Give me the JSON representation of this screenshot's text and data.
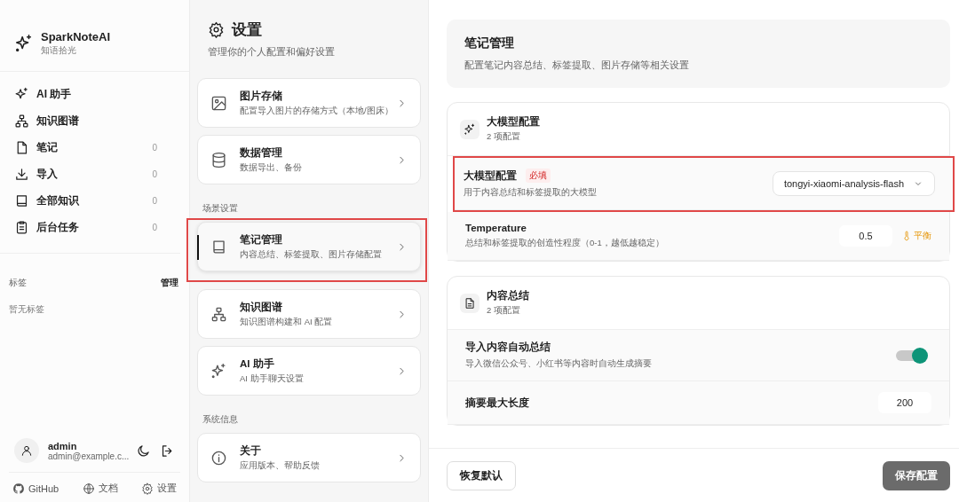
{
  "sidebar": {
    "brand": {
      "name": "SparkNoteAI",
      "tagline": "知语拾光"
    },
    "nav": [
      {
        "label": "AI 助手"
      },
      {
        "label": "知识图谱"
      },
      {
        "label": "笔记",
        "count": "0"
      },
      {
        "label": "导入",
        "count": "0"
      },
      {
        "label": "全部知识",
        "count": "0"
      },
      {
        "label": "后台任务",
        "count": "0"
      }
    ],
    "tags": {
      "title": "标签",
      "action": "管理",
      "empty": "暂无标签"
    },
    "user": {
      "name": "admin",
      "email": "admin@example.c..."
    },
    "links": [
      {
        "label": "GitHub"
      },
      {
        "label": "文档"
      },
      {
        "label": "设置"
      }
    ]
  },
  "settings_nav": {
    "title": "设置",
    "subtitle": "管理你的个人配置和偏好设置",
    "groups": [
      {
        "items": [
          {
            "title": "图片存储",
            "desc": "配置导入图片的存储方式（本地/图床）",
            "selected": false,
            "highlighted": false
          },
          {
            "title": "数据管理",
            "desc": "数据导出、备份",
            "selected": false,
            "highlighted": false
          }
        ]
      },
      {
        "label": "场景设置",
        "items": [
          {
            "title": "笔记管理",
            "desc": "内容总结、标签提取、图片存储配置",
            "selected": true,
            "highlighted": true
          },
          {
            "title": "知识图谱",
            "desc": "知识图谱构建和 AI 配置",
            "selected": false,
            "highlighted": false
          },
          {
            "title": "AI 助手",
            "desc": "AI 助手聊天设置",
            "selected": false,
            "highlighted": false
          }
        ]
      },
      {
        "label": "系统信息",
        "items": [
          {
            "title": "关于",
            "desc": "应用版本、帮助反馈",
            "selected": false,
            "highlighted": false
          }
        ]
      }
    ]
  },
  "content": {
    "title": "笔记管理",
    "subtitle": "配置笔记内容总结、标签提取、图片存储等相关设置",
    "sections": [
      {
        "title": "大模型配置",
        "count": "2 项配置",
        "rows": [
          {
            "kind": "select",
            "label": "大模型配置",
            "badge": "必填",
            "desc": "用于内容总结和标签提取的大模型",
            "value": "tongyi-xiaomi-analysis-flash",
            "highlighted": true
          },
          {
            "kind": "number",
            "label": "Temperature",
            "desc": "总结和标签提取的创造性程度（0-1，越低越稳定）",
            "value": "0.5",
            "hint": "平衡",
            "highlighted": false
          }
        ]
      },
      {
        "title": "内容总结",
        "count": "2 项配置",
        "rows": [
          {
            "kind": "toggle",
            "label": "导入内容自动总结",
            "desc": "导入微信公众号、小红书等内容时自动生成摘要",
            "on": true,
            "highlighted": false
          },
          {
            "kind": "number",
            "label": "摘要最大长度",
            "value": "200",
            "highlighted": false
          }
        ]
      }
    ]
  },
  "footer": {
    "reset": "恢复默认",
    "save": "保存配置"
  }
}
